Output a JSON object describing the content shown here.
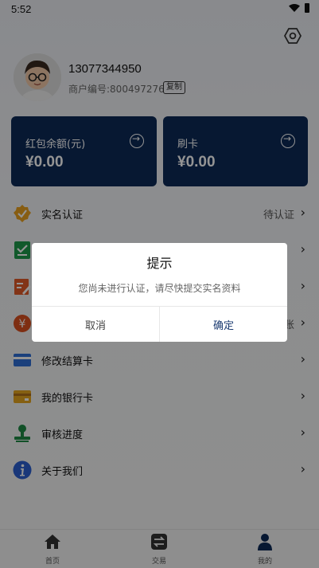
{
  "status_bar": {
    "time": "5:52"
  },
  "profile": {
    "phone": "13077344950",
    "merchant_label": "商户编号:800497276",
    "copy_label": "复制"
  },
  "cards": [
    {
      "title": "红包余额(元)",
      "amount": "¥0.00"
    },
    {
      "title": "刷卡",
      "amount": "¥0.00"
    }
  ],
  "menu": {
    "items": [
      {
        "label": "实名认证",
        "status": "待认证",
        "icon": "verified-badge-icon"
      },
      {
        "label": "",
        "status": "",
        "icon": "checklist-icon"
      },
      {
        "label": "",
        "status": "",
        "icon": "edit-document-icon"
      },
      {
        "label": "",
        "status": "账",
        "icon": "yen-coin-icon"
      },
      {
        "label": "修改结算卡",
        "status": "",
        "icon": "credit-card-icon"
      },
      {
        "label": "我的银行卡",
        "status": "",
        "icon": "wallet-card-icon"
      },
      {
        "label": "审核进度",
        "status": "",
        "icon": "stamp-icon"
      },
      {
        "label": "关于我们",
        "status": "",
        "icon": "info-icon"
      }
    ]
  },
  "dialog": {
    "title": "提示",
    "message": "您尚未进行认证，请尽快提交实名资料",
    "cancel": "取消",
    "confirm": "确定"
  },
  "tabbar": {
    "tabs": [
      {
        "label": "首页"
      },
      {
        "label": "交易"
      },
      {
        "label": "我的"
      }
    ]
  },
  "colors": {
    "card_bg": "#0d2a57",
    "accent": "#1a3a70",
    "overlay": "rgba(0,0,0,0.42)"
  }
}
